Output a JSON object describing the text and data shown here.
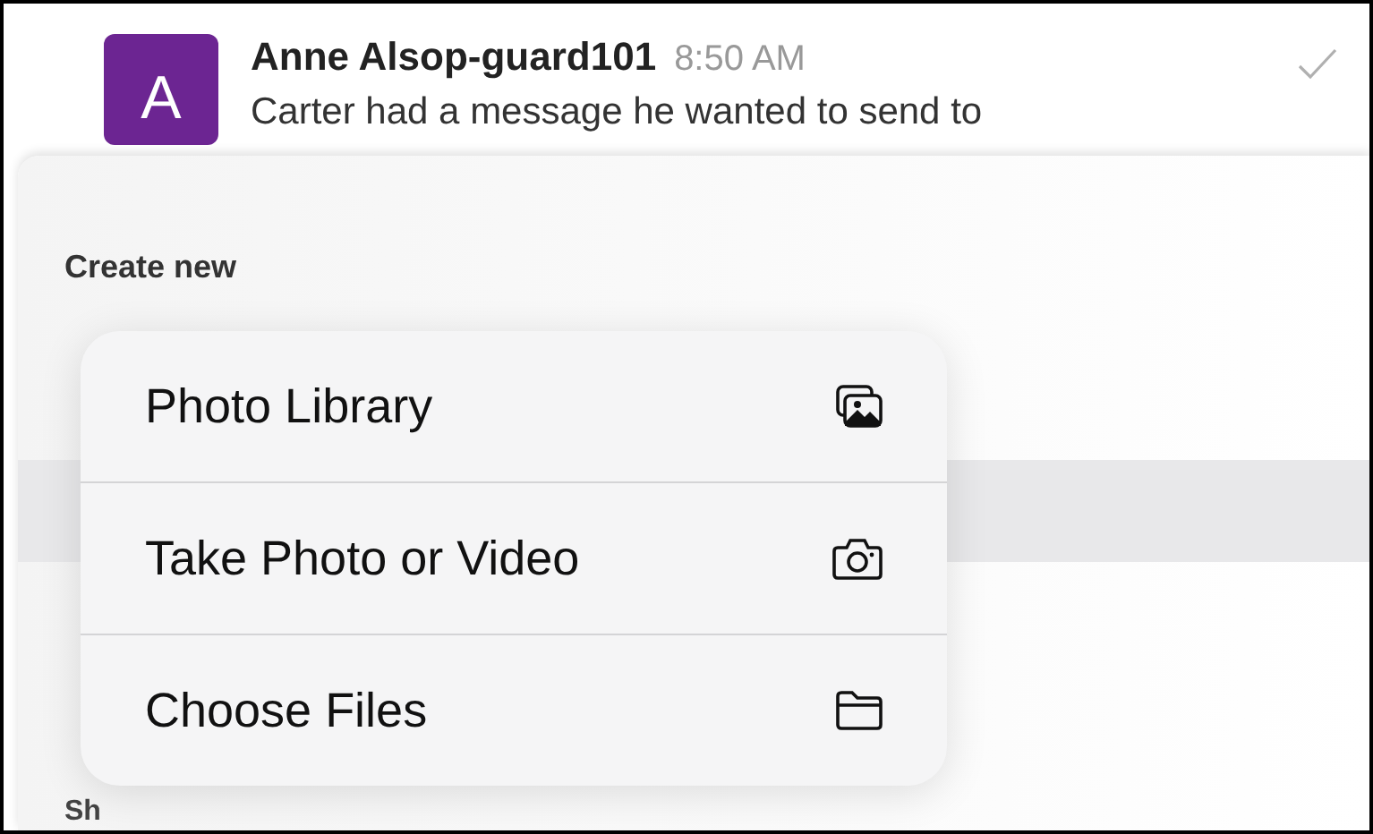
{
  "message": {
    "avatar_letter": "A",
    "author": "Anne Alsop-guard101",
    "time": "8:50 AM",
    "text": "Carter had a message he wanted to send to"
  },
  "sheet": {
    "section_title": "Create new",
    "next_section_title": "Sh"
  },
  "menu": [
    {
      "label": "Photo Library",
      "kind": "photos"
    },
    {
      "label": "Take Photo or Video",
      "kind": "camera"
    },
    {
      "label": "Choose Files",
      "kind": "folder"
    }
  ]
}
